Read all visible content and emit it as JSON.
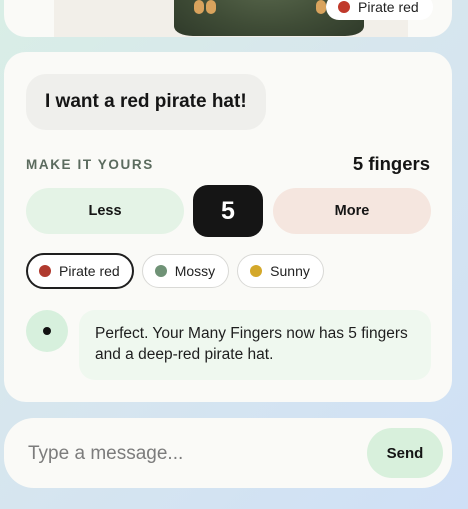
{
  "preview": {
    "chip_label": "Pirate red",
    "chip_color": "#c0392b"
  },
  "chat": {
    "user_message": "I want a red pirate hat!",
    "bot_message": "Perfect. Your Many Fingers now has 5 fingers and a deep-red pirate hat."
  },
  "customize": {
    "section_label": "MAKE IT YOURS",
    "count_text": "5 fingers",
    "less_label": "Less",
    "value": "5",
    "more_label": "More"
  },
  "colors": [
    {
      "label": "Pirate red",
      "color": "#b03a2e",
      "selected": true
    },
    {
      "label": "Mossy",
      "color": "#6f9276",
      "selected": false
    },
    {
      "label": "Sunny",
      "color": "#d4a82a",
      "selected": false
    }
  ],
  "composer": {
    "placeholder": "Type a message...",
    "send_label": "Send"
  }
}
